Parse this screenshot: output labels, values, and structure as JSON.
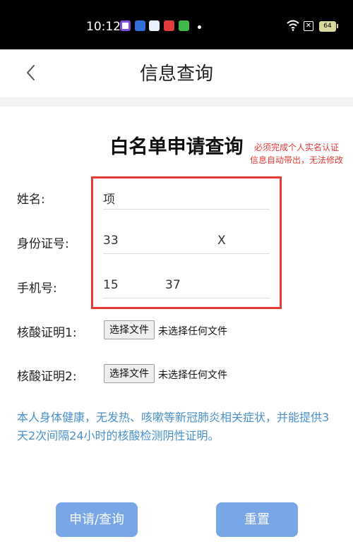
{
  "status_bar": {
    "time": "10:12",
    "sim_label": "✕",
    "battery": "64"
  },
  "nav": {
    "title": "信息查询"
  },
  "form": {
    "title": "白名单申请查询",
    "annotation_line1": "必须完成个人实名认证",
    "annotation_line2": "信息自动带出，无法修改",
    "name_label": "姓名:",
    "name_value": "项",
    "id_label": "身份证号:",
    "id_value_start": "33",
    "id_value_end": "X",
    "phone_label": "手机号:",
    "phone_value_start": "15",
    "phone_value_end": "37",
    "cert1_label": "核酸证明1:",
    "cert2_label": "核酸证明2:",
    "choose_file": "选择文件",
    "no_file": "未选择任何文件",
    "notice": "本人身体健康，无发热、咳嗽等新冠肺炎相关症状，并能提供3天2次间隔24小时的核酸检测阴性证明。"
  },
  "actions": {
    "submit": "申请/查询",
    "reset": "重置"
  },
  "colors": {
    "accent_button": "#78a6e6",
    "annotation_red": "#e53935",
    "notice_blue": "#4a90c8"
  }
}
